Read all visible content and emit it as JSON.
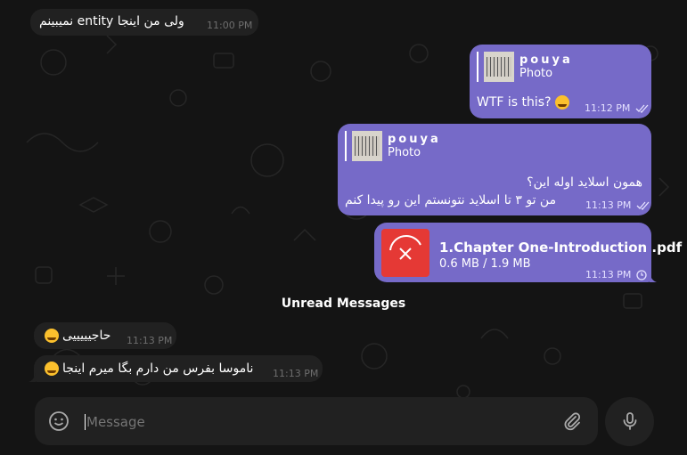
{
  "messages": {
    "m1": {
      "text": "ولی من اینجا entity نمیبینم",
      "time": "11:00 PM"
    },
    "m2": {
      "reply_name": "pouya",
      "reply_type": "Photo",
      "text": "WTF is this?",
      "emoji": "flushed-face",
      "time": "11:12 PM"
    },
    "m3": {
      "reply_name": "pouya",
      "reply_type": "Photo",
      "line1": "همون اسلاید اوله این؟",
      "line2": "من تو ۳ تا اسلاید نتونستم این رو پیدا کنم",
      "time": "11:13 PM"
    },
    "m4": {
      "file_name": "1.Chapter One-Introduction .pdf",
      "progress": "0.6 MB / 1.9 MB",
      "time": "11:13 PM"
    },
    "m5": {
      "text": "حاجیییییی",
      "emoji": "laughing-face",
      "time": "11:13 PM"
    },
    "m6": {
      "text": "ناموسا بفرس من دارم بگا میرم اینجا",
      "emoji": "laughing-face",
      "time": "11:13 PM"
    }
  },
  "divider": {
    "label": "Unread Messages"
  },
  "composer": {
    "placeholder": "Message"
  },
  "colors": {
    "outgoing": "#766ac8",
    "incoming": "#212121",
    "background": "#141414",
    "file_icon": "#e53935"
  }
}
